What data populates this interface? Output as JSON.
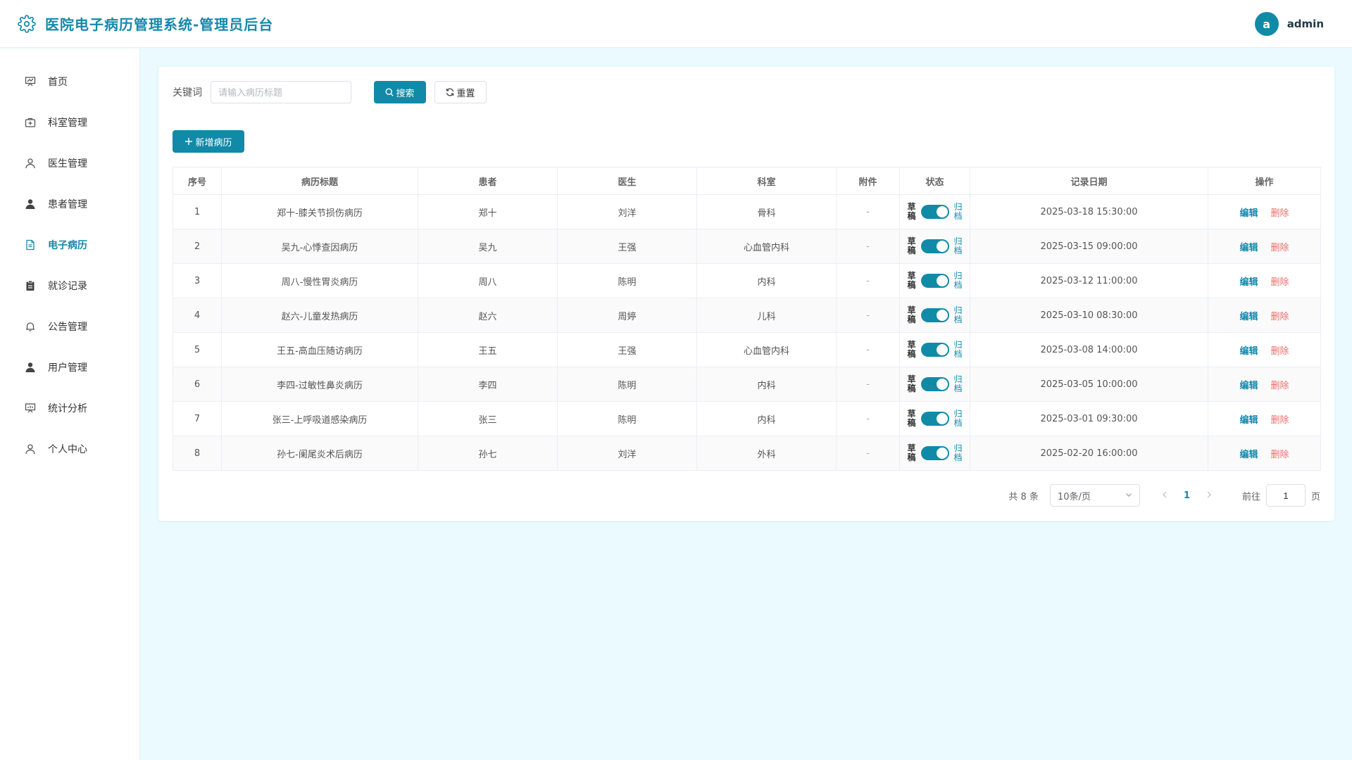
{
  "app": {
    "title": "医院电子病历管理系统-管理员后台"
  },
  "user": {
    "avatar_letter": "a",
    "name": "admin"
  },
  "sidebar": {
    "items": [
      {
        "label": "首页",
        "icon": "presentation-icon"
      },
      {
        "label": "科室管理",
        "icon": "first-aid-kit-icon"
      },
      {
        "label": "医生管理",
        "icon": "user-outline-icon"
      },
      {
        "label": "患者管理",
        "icon": "user-filled-icon"
      },
      {
        "label": "电子病历",
        "icon": "document-icon",
        "active": true
      },
      {
        "label": "就诊记录",
        "icon": "clipboard-icon"
      },
      {
        "label": "公告管理",
        "icon": "bell-icon"
      },
      {
        "label": "用户管理",
        "icon": "user-filled-icon"
      },
      {
        "label": "统计分析",
        "icon": "chart-board-icon"
      },
      {
        "label": "个人中心",
        "icon": "user-outline-icon"
      }
    ]
  },
  "search": {
    "label": "关键词",
    "placeholder": "请输入病历标题",
    "value": "",
    "search_label": "搜索",
    "reset_label": "重置"
  },
  "toolbar": {
    "add_label": "新增病历"
  },
  "table": {
    "headers": [
      "序号",
      "病历标题",
      "患者",
      "医生",
      "科室",
      "附件",
      "状态",
      "记录日期",
      "操作"
    ],
    "status_off": "草稿",
    "status_on": "归档",
    "edit_label": "编辑",
    "delete_label": "删除",
    "rows": [
      {
        "index": "1",
        "title": "郑十-膝关节损伤病历",
        "patient": "郑十",
        "doctor": "刘洋",
        "dept": "骨科",
        "attachment": "-",
        "archived": true,
        "date": "2025-03-18 15:30:00"
      },
      {
        "index": "2",
        "title": "吴九-心悸查因病历",
        "patient": "吴九",
        "doctor": "王强",
        "dept": "心血管内科",
        "attachment": "-",
        "archived": true,
        "date": "2025-03-15 09:00:00"
      },
      {
        "index": "3",
        "title": "周八-慢性胃炎病历",
        "patient": "周八",
        "doctor": "陈明",
        "dept": "内科",
        "attachment": "-",
        "archived": true,
        "date": "2025-03-12 11:00:00"
      },
      {
        "index": "4",
        "title": "赵六-儿童发热病历",
        "patient": "赵六",
        "doctor": "周婷",
        "dept": "儿科",
        "attachment": "-",
        "archived": true,
        "date": "2025-03-10 08:30:00"
      },
      {
        "index": "5",
        "title": "王五-高血压随访病历",
        "patient": "王五",
        "doctor": "王强",
        "dept": "心血管内科",
        "attachment": "-",
        "archived": true,
        "date": "2025-03-08 14:00:00"
      },
      {
        "index": "6",
        "title": "李四-过敏性鼻炎病历",
        "patient": "李四",
        "doctor": "陈明",
        "dept": "内科",
        "attachment": "-",
        "archived": true,
        "date": "2025-03-05 10:00:00"
      },
      {
        "index": "7",
        "title": "张三-上呼吸道感染病历",
        "patient": "张三",
        "doctor": "陈明",
        "dept": "内科",
        "attachment": "-",
        "archived": true,
        "date": "2025-03-01 09:30:00"
      },
      {
        "index": "8",
        "title": "孙七-阑尾炎术后病历",
        "patient": "孙七",
        "doctor": "刘洋",
        "dept": "外科",
        "attachment": "-",
        "archived": true,
        "date": "2025-02-20 16:00:00"
      }
    ]
  },
  "pagination": {
    "total_text": "共 8 条",
    "page_size": "10条/页",
    "current_page": "1",
    "goto_label": "前往",
    "goto_value": "1",
    "page_unit": "页"
  },
  "colors": {
    "primary": "#118aa8",
    "danger": "#f26b6b",
    "background": "#eafaff"
  }
}
